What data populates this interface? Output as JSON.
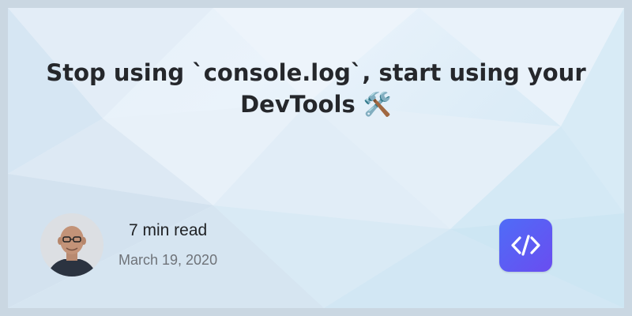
{
  "post": {
    "title": "Stop using `console.log`, start using your DevTools",
    "title_emoji": "🛠️",
    "read_time": "7 min read",
    "date": "March 19, 2020"
  },
  "author": {
    "avatar_icon": "author-avatar"
  },
  "brand": {
    "logo_icon": "code-brackets-icon",
    "logo_color": "#5b5cf2"
  },
  "colors": {
    "title": "#25272b",
    "date": "#6f7379",
    "frame": "#cad7e2"
  }
}
